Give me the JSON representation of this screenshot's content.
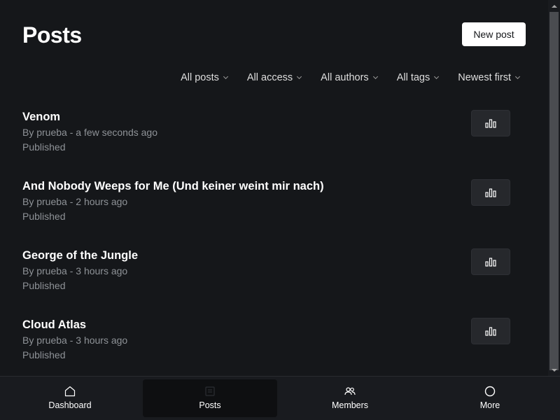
{
  "header": {
    "title": "Posts",
    "new_post_label": "New post"
  },
  "filters": [
    {
      "label": "All posts"
    },
    {
      "label": "All access"
    },
    {
      "label": "All authors"
    },
    {
      "label": "All tags"
    },
    {
      "label": "Newest first"
    }
  ],
  "posts": [
    {
      "title": "Venom",
      "meta": "By prueba - a few seconds ago",
      "status": "Published"
    },
    {
      "title": "And Nobody Weeps for Me (Und keiner weint mir nach)",
      "meta": "By prueba - 2 hours ago",
      "status": "Published"
    },
    {
      "title": "George of the Jungle",
      "meta": "By prueba - 3 hours ago",
      "status": "Published"
    },
    {
      "title": "Cloud Atlas",
      "meta": "By prueba - 3 hours ago",
      "status": "Published"
    }
  ],
  "nav": [
    {
      "label": "Dashboard",
      "icon": "home-icon",
      "active": false
    },
    {
      "label": "Posts",
      "icon": "posts-icon",
      "active": true
    },
    {
      "label": "Members",
      "icon": "members-icon",
      "active": false
    },
    {
      "label": "More",
      "icon": "more-icon",
      "active": false
    }
  ],
  "colors": {
    "background": "#15171a",
    "text_primary": "#ffffff",
    "text_muted": "#8e9297",
    "button_primary_bg": "#ffffff",
    "analytics_button_bg": "#26282c",
    "nav_bg": "#191b1f",
    "nav_active_bg": "#0e0f11"
  }
}
